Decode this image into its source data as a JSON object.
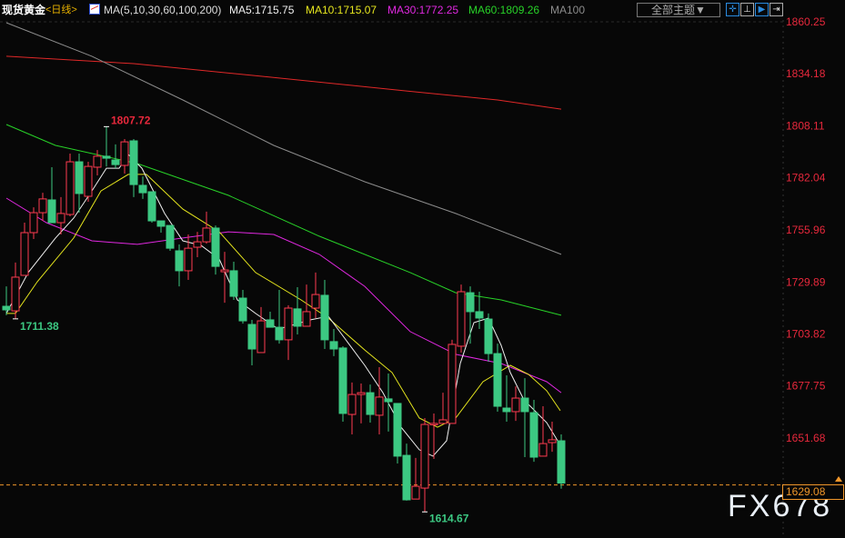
{
  "header": {
    "symbol": "现货黄金",
    "period": "<日线>",
    "ma_label": "MA(5,10,30,60,100,200)",
    "ma5": "MA5:1715.75",
    "ma10": "MA10:1715.07",
    "ma30": "MA30:1772.25",
    "ma60": "MA60:1809.26",
    "ma100": "MA100",
    "theme_button": "全部主题▼",
    "tools": [
      "crosshair-icon",
      "interval-icon",
      "play-icon",
      "exit-icon"
    ]
  },
  "watermark": "FX678",
  "colors": {
    "up": "#ff3b50",
    "down": "#3cc882",
    "ma5": "#f0f0f0",
    "ma10": "#e6e61e",
    "ma30": "#e028e0",
    "ma60": "#28d228",
    "ma100": "#8c8c8c",
    "ma200": "#e02828",
    "axis": "#e8283c",
    "last": "#f0962a"
  },
  "chart_data": {
    "type": "candlestick",
    "title": "现货黄金 日线",
    "ylim": [
      1603,
      1862
    ],
    "y_ticks": [
      "1860.25",
      "1834.18",
      "1808.11",
      "1782.04",
      "1755.96",
      "1729.89",
      "1703.82",
      "1677.75",
      "1651.68"
    ],
    "last_price": "1629.08",
    "high_label": "1807.72",
    "low_label": "1614.67",
    "high_label_index": 11,
    "low_label_index": 46,
    "ohlc": [
      [
        1717.7,
        1727.7,
        1713.2,
        1715.9
      ],
      [
        1715.4,
        1739.6,
        1711.4,
        1732.3
      ],
      [
        1733.2,
        1759.6,
        1733.2,
        1754.6
      ],
      [
        1754.6,
        1767.3,
        1751.4,
        1764.6
      ],
      [
        1764.6,
        1774.6,
        1760.5,
        1771.5
      ],
      [
        1771.0,
        1787.4,
        1759.6,
        1759.6
      ],
      [
        1759.6,
        1772.4,
        1753.7,
        1764.2
      ],
      [
        1763.7,
        1794.2,
        1762.8,
        1790.1
      ],
      [
        1790.1,
        1794.2,
        1764.6,
        1774.2
      ],
      [
        1772.8,
        1790.1,
        1770.1,
        1787.8
      ],
      [
        1787.4,
        1796.0,
        1783.3,
        1792.9
      ],
      [
        1792.9,
        1807.7,
        1787.8,
        1791.9
      ],
      [
        1791.0,
        1798.8,
        1786.9,
        1788.7
      ],
      [
        1788.3,
        1801.5,
        1784.2,
        1800.1
      ],
      [
        1800.6,
        1801.5,
        1772.4,
        1778.7
      ],
      [
        1778.3,
        1782.8,
        1771.5,
        1774.6
      ],
      [
        1775.1,
        1775.1,
        1759.6,
        1760.5
      ],
      [
        1760.5,
        1760.5,
        1754.6,
        1757.8
      ],
      [
        1758.2,
        1758.2,
        1745.5,
        1746.8
      ],
      [
        1745.5,
        1748.7,
        1727.7,
        1735.5
      ],
      [
        1735.5,
        1753.7,
        1730.9,
        1746.8
      ],
      [
        1747.3,
        1755.0,
        1742.3,
        1750.0
      ],
      [
        1750.0,
        1765.1,
        1749.1,
        1756.9
      ],
      [
        1756.9,
        1758.2,
        1733.6,
        1737.7
      ],
      [
        1735.0,
        1745.0,
        1719.5,
        1735.9
      ],
      [
        1735.5,
        1740.0,
        1720.9,
        1722.7
      ],
      [
        1721.8,
        1725.9,
        1709.0,
        1710.4
      ],
      [
        1708.6,
        1710.9,
        1688.1,
        1696.3
      ],
      [
        1694.5,
        1717.3,
        1694.5,
        1710.4
      ],
      [
        1710.9,
        1715.0,
        1707.2,
        1707.2
      ],
      [
        1707.2,
        1725.9,
        1699.0,
        1700.9
      ],
      [
        1700.9,
        1718.2,
        1690.8,
        1716.8
      ],
      [
        1716.4,
        1727.3,
        1703.6,
        1707.7
      ],
      [
        1707.7,
        1728.6,
        1707.7,
        1715.0
      ],
      [
        1716.8,
        1734.6,
        1711.8,
        1723.6
      ],
      [
        1723.2,
        1730.9,
        1696.3,
        1700.9
      ],
      [
        1700.0,
        1706.3,
        1692.7,
        1696.3
      ],
      [
        1696.8,
        1697.7,
        1659.9,
        1664.0
      ],
      [
        1663.5,
        1679.5,
        1653.5,
        1673.5
      ],
      [
        1673.5,
        1679.0,
        1659.0,
        1674.4
      ],
      [
        1674.4,
        1678.5,
        1659.4,
        1663.5
      ],
      [
        1663.1,
        1687.2,
        1653.5,
        1672.2
      ],
      [
        1671.3,
        1684.0,
        1654.9,
        1669.9
      ],
      [
        1669.0,
        1669.0,
        1638.9,
        1642.6
      ],
      [
        1643.0,
        1648.9,
        1620.3,
        1620.7
      ],
      [
        1621.1,
        1641.7,
        1621.1,
        1627.5
      ],
      [
        1626.6,
        1661.7,
        1614.7,
        1658.5
      ],
      [
        1658.5,
        1664.0,
        1641.2,
        1659.0
      ],
      [
        1659.0,
        1674.4,
        1659.0,
        1660.8
      ],
      [
        1659.0,
        1700.9,
        1659.0,
        1698.6
      ],
      [
        1697.7,
        1728.6,
        1694.5,
        1725.0
      ],
      [
        1724.5,
        1727.7,
        1699.0,
        1715.0
      ],
      [
        1715.0,
        1725.0,
        1706.3,
        1711.8
      ],
      [
        1711.3,
        1714.1,
        1689.9,
        1694.0
      ],
      [
        1694.0,
        1699.0,
        1664.9,
        1667.6
      ],
      [
        1666.7,
        1683.1,
        1659.9,
        1664.9
      ],
      [
        1664.9,
        1677.6,
        1660.3,
        1671.7
      ],
      [
        1671.7,
        1681.7,
        1642.1,
        1664.9
      ],
      [
        1664.4,
        1670.8,
        1639.8,
        1642.1
      ],
      [
        1642.6,
        1667.6,
        1642.6,
        1648.9
      ],
      [
        1649.4,
        1659.9,
        1644.8,
        1650.8
      ],
      [
        1650.3,
        1653.5,
        1626.3,
        1629.08
      ]
    ],
    "ma_series": [
      {
        "name": "MA200",
        "points": [
          [
            0,
            1843.0
          ],
          [
            14,
            1839.3
          ],
          [
            29,
            1832.5
          ],
          [
            44,
            1825.6
          ],
          [
            54,
            1821.1
          ],
          [
            61,
            1816.5
          ]
        ]
      },
      {
        "name": "MA100",
        "points": [
          [
            0,
            1859.8
          ],
          [
            9.4,
            1843.0
          ],
          [
            19.4,
            1821.1
          ],
          [
            29.4,
            1798.3
          ],
          [
            39.4,
            1780.1
          ],
          [
            49.4,
            1764.2
          ],
          [
            61,
            1743.7
          ]
        ]
      },
      {
        "name": "MA60",
        "points": [
          [
            0,
            1808.8
          ],
          [
            5.4,
            1798.3
          ],
          [
            14.4,
            1789.2
          ],
          [
            24.4,
            1773.3
          ],
          [
            34.4,
            1752.8
          ],
          [
            44.4,
            1734.6
          ],
          [
            49.4,
            1724.5
          ],
          [
            54.4,
            1720.9
          ],
          [
            61,
            1713.2
          ]
        ]
      },
      {
        "name": "MA30",
        "points": [
          [
            0,
            1771.9
          ],
          [
            4.4,
            1759.6
          ],
          [
            9.4,
            1750.5
          ],
          [
            14.4,
            1748.7
          ],
          [
            19.4,
            1751.9
          ],
          [
            24.4,
            1755.0
          ],
          [
            29.4,
            1753.7
          ],
          [
            34.4,
            1743.7
          ],
          [
            39.4,
            1727.7
          ],
          [
            44.4,
            1705.0
          ],
          [
            49.4,
            1693.6
          ],
          [
            54.4,
            1689.0
          ],
          [
            59.4,
            1679.9
          ],
          [
            61,
            1674.4
          ]
        ]
      },
      {
        "name": "MA10",
        "points": [
          [
            0,
            1714.1
          ],
          [
            1,
            1714.1
          ],
          [
            3.4,
            1730.0
          ],
          [
            7.4,
            1751.9
          ],
          [
            10.4,
            1775.5
          ],
          [
            13.4,
            1783.8
          ],
          [
            15.4,
            1783.8
          ],
          [
            19.4,
            1766.4
          ],
          [
            23.4,
            1755.0
          ],
          [
            27.4,
            1734.6
          ],
          [
            32.4,
            1720.9
          ],
          [
            35.4,
            1711.8
          ],
          [
            39.4,
            1695.8
          ],
          [
            42.4,
            1684.5
          ],
          [
            45.4,
            1661.7
          ],
          [
            47.4,
            1657.1
          ],
          [
            49.4,
            1661.7
          ],
          [
            52.4,
            1679.9
          ],
          [
            55.4,
            1688.1
          ],
          [
            57.4,
            1683.6
          ],
          [
            59.4,
            1675.4
          ],
          [
            60.9,
            1665.4
          ]
        ]
      },
      {
        "name": "MA5",
        "points": [
          [
            0,
            1714.1
          ],
          [
            2.4,
            1734.6
          ],
          [
            5.4,
            1751.9
          ],
          [
            7.4,
            1761.9
          ],
          [
            9.4,
            1775.5
          ],
          [
            11,
            1786.9
          ],
          [
            12.4,
            1786.9
          ],
          [
            13.4,
            1793.8
          ],
          [
            14.9,
            1786.9
          ],
          [
            17.4,
            1764.2
          ],
          [
            19.4,
            1750.5
          ],
          [
            21.4,
            1748.2
          ],
          [
            23.4,
            1741.4
          ],
          [
            25.4,
            1720.9
          ],
          [
            27.4,
            1714.1
          ],
          [
            29.9,
            1706.3
          ],
          [
            31.4,
            1708.2
          ],
          [
            33.4,
            1710.9
          ],
          [
            35.4,
            1712.7
          ],
          [
            37.4,
            1700.4
          ],
          [
            39.4,
            1688.1
          ],
          [
            41.4,
            1674.4
          ],
          [
            43.4,
            1657.1
          ],
          [
            45.4,
            1645.8
          ],
          [
            46.9,
            1642.6
          ],
          [
            48.4,
            1650.3
          ],
          [
            49.9,
            1689.0
          ],
          [
            51.4,
            1709.5
          ],
          [
            53,
            1711.8
          ],
          [
            54.4,
            1698.1
          ],
          [
            55.4,
            1684.5
          ],
          [
            56.9,
            1670.8
          ],
          [
            59.4,
            1659.4
          ],
          [
            60.9,
            1648.1
          ]
        ]
      }
    ]
  }
}
